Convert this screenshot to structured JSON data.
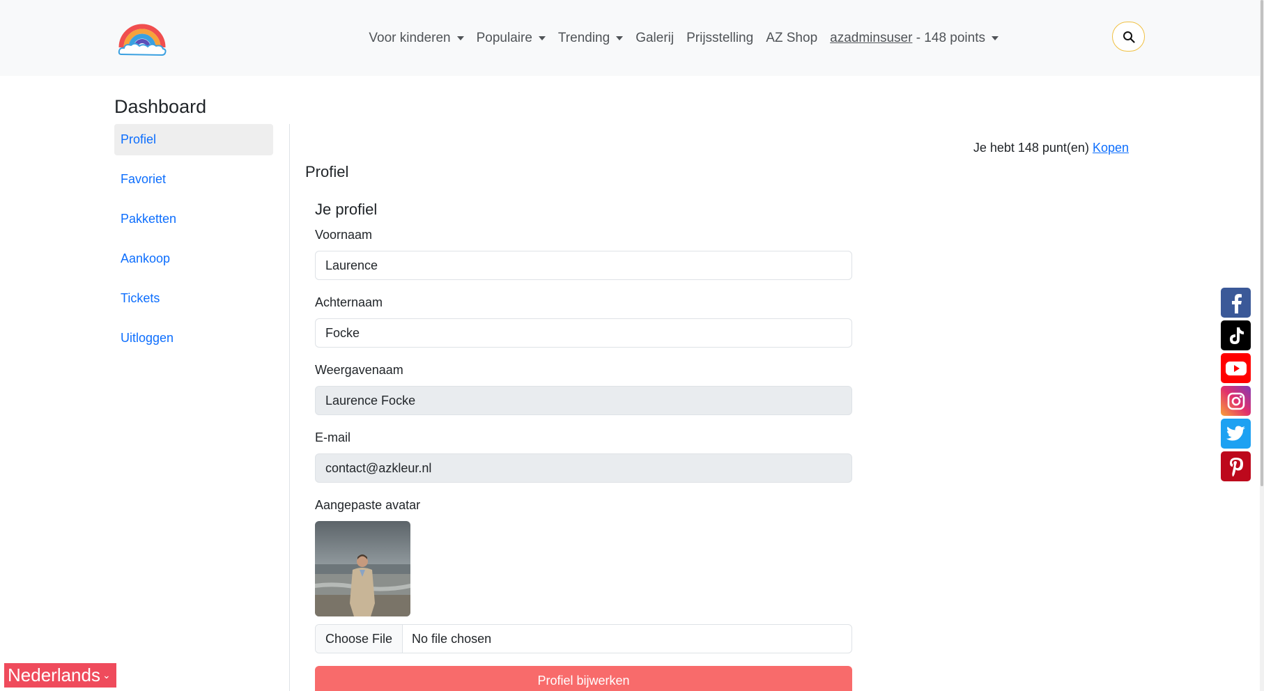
{
  "nav": {
    "items": [
      {
        "label": "Voor kinderen",
        "dropdown": true
      },
      {
        "label": "Populaire",
        "dropdown": true
      },
      {
        "label": "Trending",
        "dropdown": true
      },
      {
        "label": "Galerij",
        "dropdown": false
      },
      {
        "label": "Prijsstelling",
        "dropdown": false
      },
      {
        "label": "AZ Shop",
        "dropdown": false
      }
    ],
    "user": {
      "name": "azadminsuser",
      "points_suffix": " - 148 points"
    },
    "search_icon": "search-icon"
  },
  "dashboard": {
    "title": "Dashboard"
  },
  "sidebar": {
    "items": [
      {
        "label": "Profiel",
        "active": true
      },
      {
        "label": "Favoriet",
        "active": false
      },
      {
        "label": "Pakketten",
        "active": false
      },
      {
        "label": "Aankoop",
        "active": false
      },
      {
        "label": "Tickets",
        "active": false
      },
      {
        "label": "Uitloggen",
        "active": false
      }
    ]
  },
  "points": {
    "text": "Je hebt 148 punt(en) ",
    "link": "Kopen"
  },
  "section": {
    "title": "Profiel"
  },
  "profile": {
    "heading": "Je profiel",
    "first_name": {
      "label": "Voornaam",
      "value": "Laurence"
    },
    "last_name": {
      "label": "Achternaam",
      "value": "Focke"
    },
    "display_name": {
      "label": "Weergavenaam",
      "value": "Laurence Focke"
    },
    "email": {
      "label": "E-mail",
      "value": "contact@azkleur.nl"
    },
    "avatar": {
      "label": "Aangepaste avatar"
    },
    "file": {
      "button": "Choose File",
      "status": "No file chosen"
    },
    "submit": "Profiel bijwerken"
  },
  "social": [
    {
      "icon": "facebook-icon",
      "color": "#3b5998"
    },
    {
      "icon": "tiktok-icon",
      "color": "#000000"
    },
    {
      "icon": "youtube-icon",
      "color": "#ff0000"
    },
    {
      "icon": "instagram-icon",
      "color": "#c13584"
    },
    {
      "icon": "twitter-icon",
      "color": "#1da1f2"
    },
    {
      "icon": "pinterest-icon",
      "color": "#bd081c"
    }
  ],
  "language": {
    "label": "Nederlands",
    "caret": "⌄"
  },
  "colors": {
    "accent": "#0d6efd",
    "button": "#f86b6b",
    "language_bg": "#ef4b5c"
  }
}
